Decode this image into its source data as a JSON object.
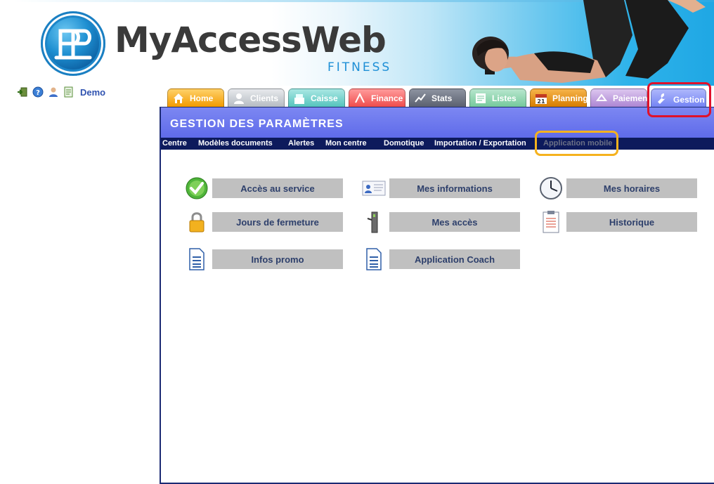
{
  "brand": {
    "name": "MyAccessWeb",
    "sub": "FITNESS"
  },
  "userbar": {
    "user_label": "Demo",
    "icons": [
      "exit-icon",
      "help-icon",
      "user-icon",
      "document-icon"
    ]
  },
  "tabs": [
    {
      "label": "Home",
      "icon": "home-icon"
    },
    {
      "label": "Clients",
      "icon": "person-icon"
    },
    {
      "label": "Caisse",
      "icon": "cash-register-icon"
    },
    {
      "label": "Finance",
      "icon": "finance-icon"
    },
    {
      "label": "Stats",
      "icon": "chart-icon"
    },
    {
      "label": "Listes",
      "icon": "list-icon"
    },
    {
      "label": "Planning",
      "icon": "calendar-icon",
      "badge": "21"
    },
    {
      "label": "Paiements",
      "icon": "payment-icon"
    },
    {
      "label": "Gestion",
      "icon": "wrench-icon",
      "active": true
    }
  ],
  "page": {
    "title": "GESTION DES PARAMÈTRES"
  },
  "subnav": [
    {
      "label": "Centre"
    },
    {
      "label": "Modèles documents"
    },
    {
      "label": "Alertes"
    },
    {
      "label": "Mon centre"
    },
    {
      "label": "Domotique"
    },
    {
      "label": "Importation / Exportation"
    },
    {
      "label": "Application mobile",
      "disabled": true
    }
  ],
  "items": [
    {
      "label": "Accès au service",
      "icon": "checkmark-icon"
    },
    {
      "label": "Mes informations",
      "icon": "id-card-icon"
    },
    {
      "label": "Mes horaires",
      "icon": "clock-icon"
    },
    {
      "label": "Jours de fermeture",
      "icon": "padlock-icon"
    },
    {
      "label": "Mes accès",
      "icon": "turnstile-icon"
    },
    {
      "label": "Historique",
      "icon": "clipboard-icon"
    },
    {
      "label": "Infos promo",
      "icon": "document-icon"
    },
    {
      "label": "Application Coach",
      "icon": "document-icon"
    }
  ],
  "colors": {
    "panel_header": "#6b77ee",
    "subnav_bg": "#0d1a5c",
    "button_bg": "#c0c0c0",
    "button_text": "#2d3f6b",
    "highlight_red": "#e0112b",
    "highlight_orange": "#f5b21e"
  }
}
